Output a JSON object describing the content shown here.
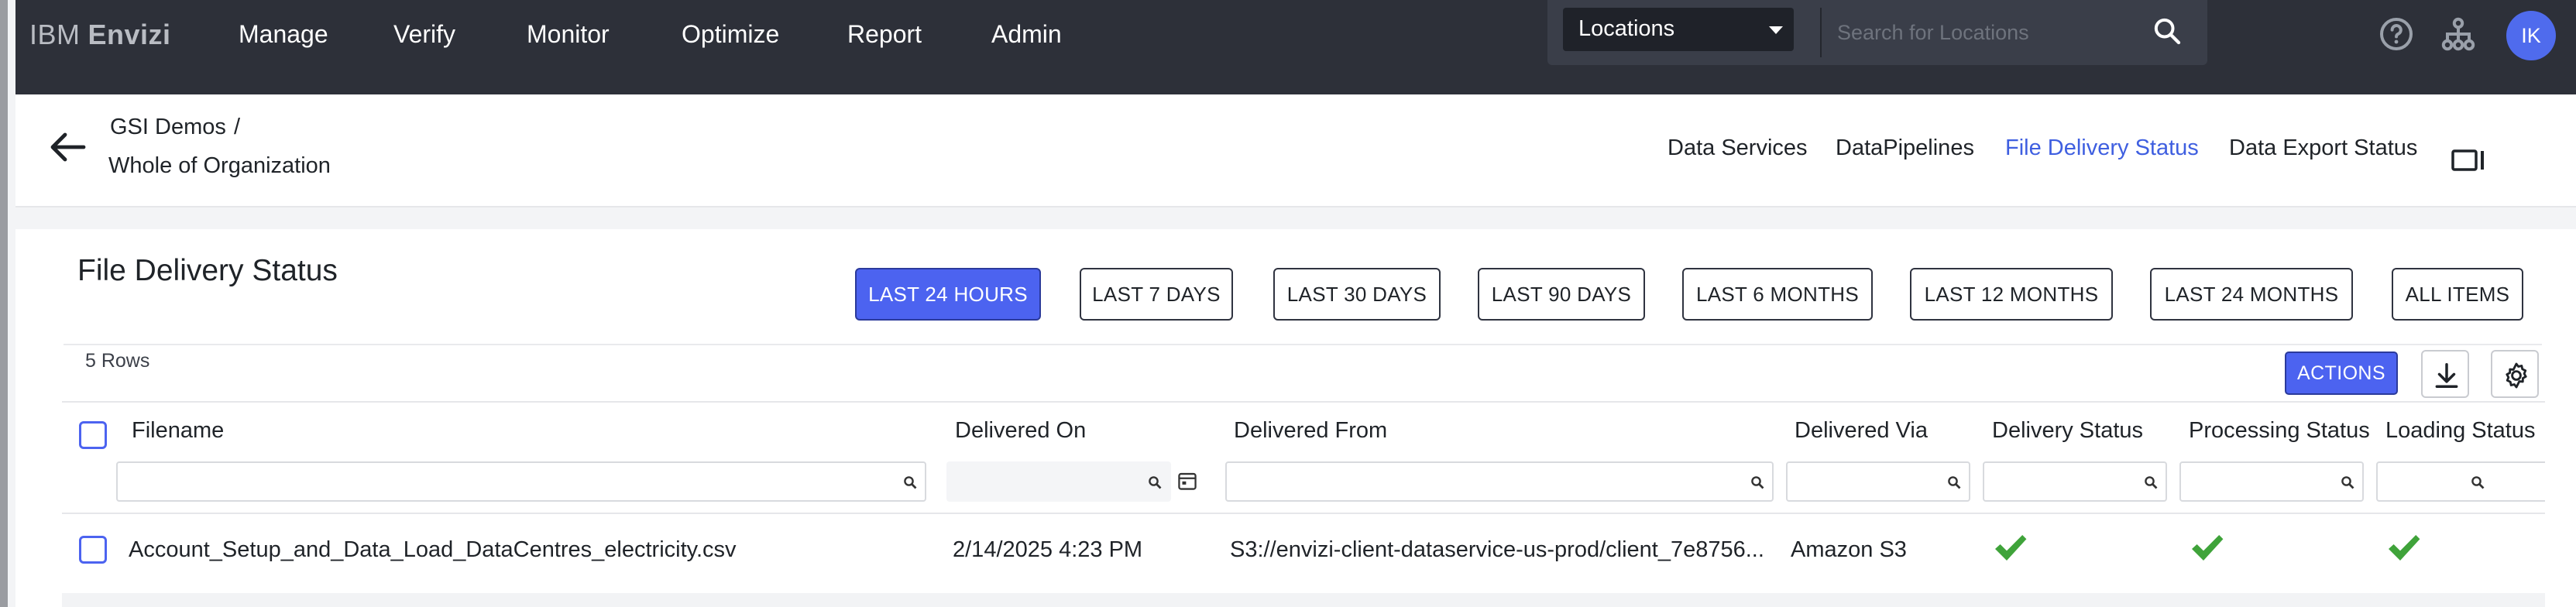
{
  "app": {
    "brand_prefix": "IBM",
    "brand_name": "Envizi"
  },
  "nav": {
    "items": [
      "Manage",
      "Verify",
      "Monitor",
      "Optimize",
      "Report",
      "Admin"
    ]
  },
  "search": {
    "scope": "Locations",
    "placeholder": "Search for Locations"
  },
  "user": {
    "initials": "IK"
  },
  "breadcrumb": {
    "parent": "GSI Demos",
    "separator": "/",
    "current": "Whole of Organization"
  },
  "tabs": [
    {
      "label": "Data Services",
      "active": false
    },
    {
      "label": "DataPipelines",
      "active": false
    },
    {
      "label": "File Delivery Status",
      "active": true
    },
    {
      "label": "Data Export Status",
      "active": false
    }
  ],
  "page": {
    "title": "File Delivery Status"
  },
  "time_ranges": [
    "LAST 24 HOURS",
    "LAST 7 DAYS",
    "LAST 30 DAYS",
    "LAST 90 DAYS",
    "LAST 6 MONTHS",
    "LAST 12 MONTHS",
    "LAST 24 MONTHS",
    "ALL ITEMS"
  ],
  "active_time_range": "LAST 24 HOURS",
  "table": {
    "row_count_label": "5 Rows",
    "actions_label": "ACTIONS",
    "columns": [
      "Filename",
      "Delivered On",
      "Delivered From",
      "Delivered Via",
      "Delivery Status",
      "Processing Status",
      "Loading Status"
    ],
    "rows": [
      {
        "filename": "Account_Setup_and_Data_Load_DataCentres_electricity.csv",
        "delivered_on": "2/14/2025 4:23 PM",
        "delivered_from": "S3://envizi-client-dataservice-us-prod/client_7e8756...",
        "delivered_via": "Amazon S3",
        "delivery_status": "success",
        "processing_status": "success",
        "loading_status": "success"
      }
    ]
  },
  "colors": {
    "accent": "#4c63f0",
    "nav_bg": "#2d3039",
    "active_tab": "#3f5fe0",
    "success": "#3fa33a"
  }
}
